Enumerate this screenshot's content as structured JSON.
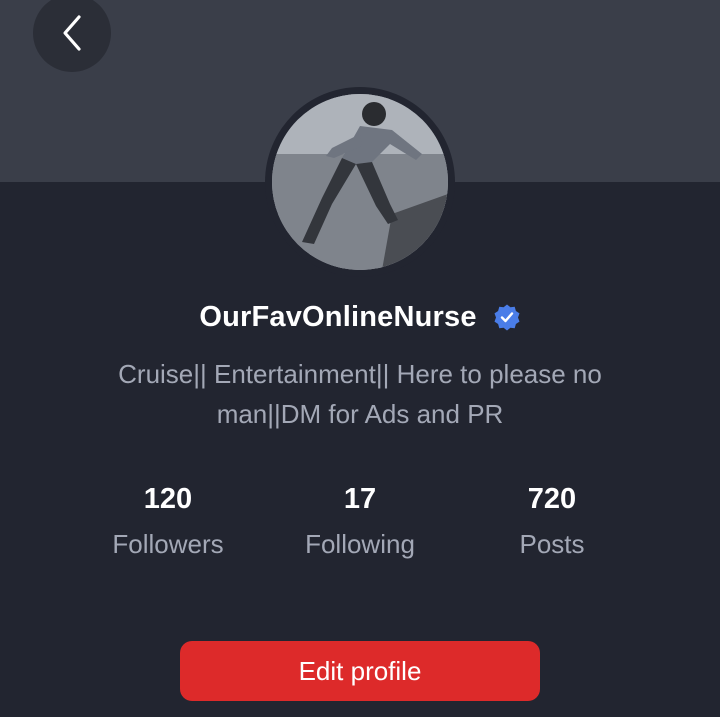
{
  "header": {
    "back_icon": "chevron-left-icon",
    "banner_color": "#3a3e49"
  },
  "profile": {
    "avatar_icon": "profile-photo",
    "username": "OurFavOnlineNurse",
    "verified_icon": "verified-badge-icon",
    "verified_color": "#4a7de8",
    "bio_line1": "Cruise|| Entertainment|| Here to please no",
    "bio_line2": "man||DM for Ads and PR"
  },
  "stats": [
    {
      "count": "120",
      "label": "Followers"
    },
    {
      "count": "17",
      "label": "Following"
    },
    {
      "count": "720",
      "label": "Posts"
    }
  ],
  "actions": {
    "edit_profile_label": "Edit profile",
    "edit_profile_color": "#dd2a2a"
  }
}
